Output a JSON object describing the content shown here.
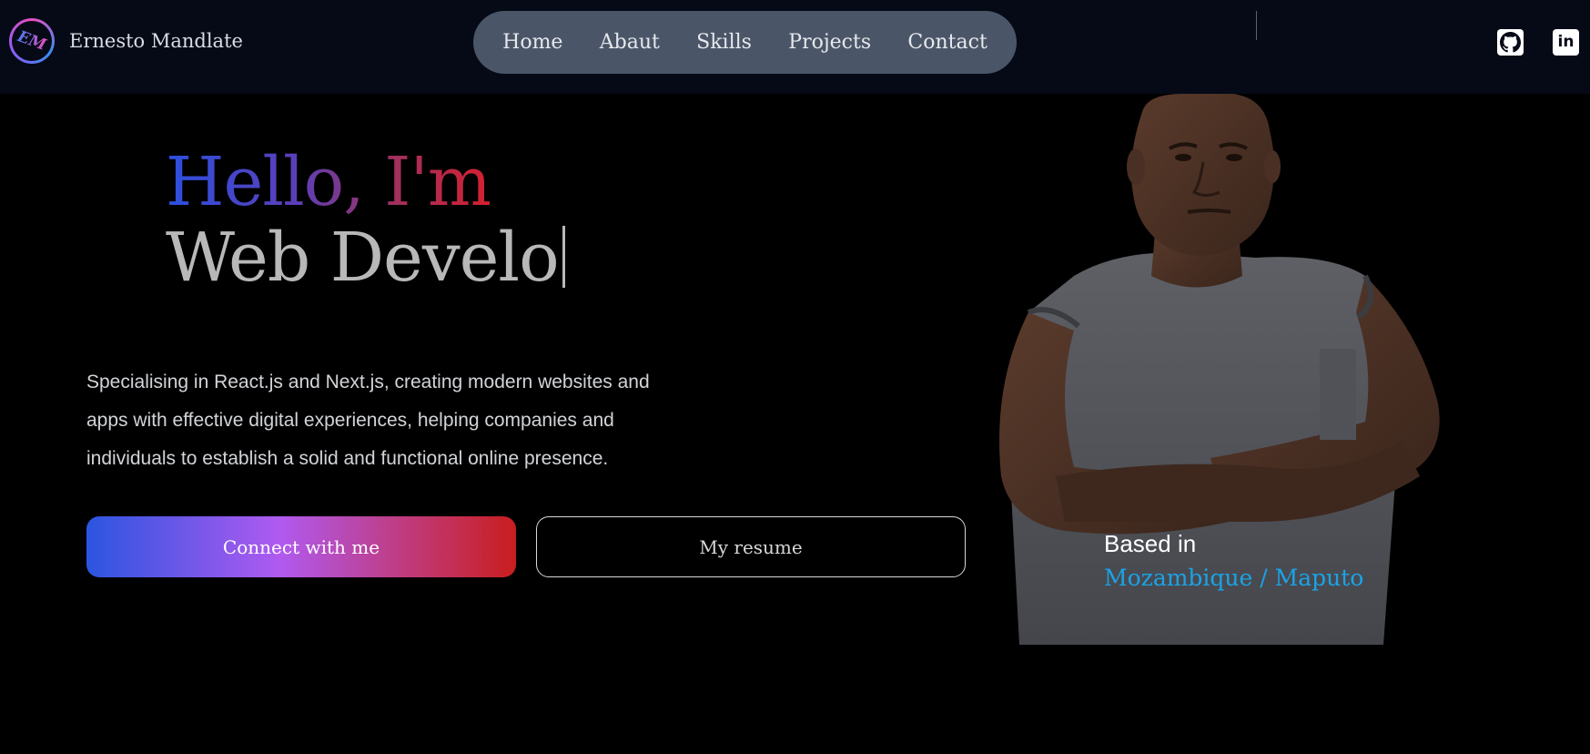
{
  "header": {
    "logo_initials": "EM",
    "brand_name": "Ernesto Mandlate",
    "nav": [
      {
        "label": "Home"
      },
      {
        "label": "Abaut"
      },
      {
        "label": "Skills"
      },
      {
        "label": "Projects"
      },
      {
        "label": "Contact"
      }
    ],
    "social": [
      {
        "icon": "github-icon"
      },
      {
        "icon": "linkedin-icon",
        "glyph": "in"
      }
    ]
  },
  "hero": {
    "greeting": "Hello, I'm",
    "role_typed": "Web Develo",
    "description": "Specialising in React.js and Next.js, creating modern websites and apps with effective digital experiences, helping companies and individuals to establish a solid and functional online presence.",
    "primary_button": "Connect with me",
    "secondary_button": "My resume"
  },
  "location": {
    "label": "Based in",
    "value": "Mozambique / Maputo"
  },
  "colors": {
    "header_bg": "#050a16",
    "nav_bg": "#4a5668",
    "page_bg": "#000000",
    "accent_blue": "#2c4fe0",
    "accent_red": "#d42030",
    "location_blue": "#1aa3e8"
  }
}
